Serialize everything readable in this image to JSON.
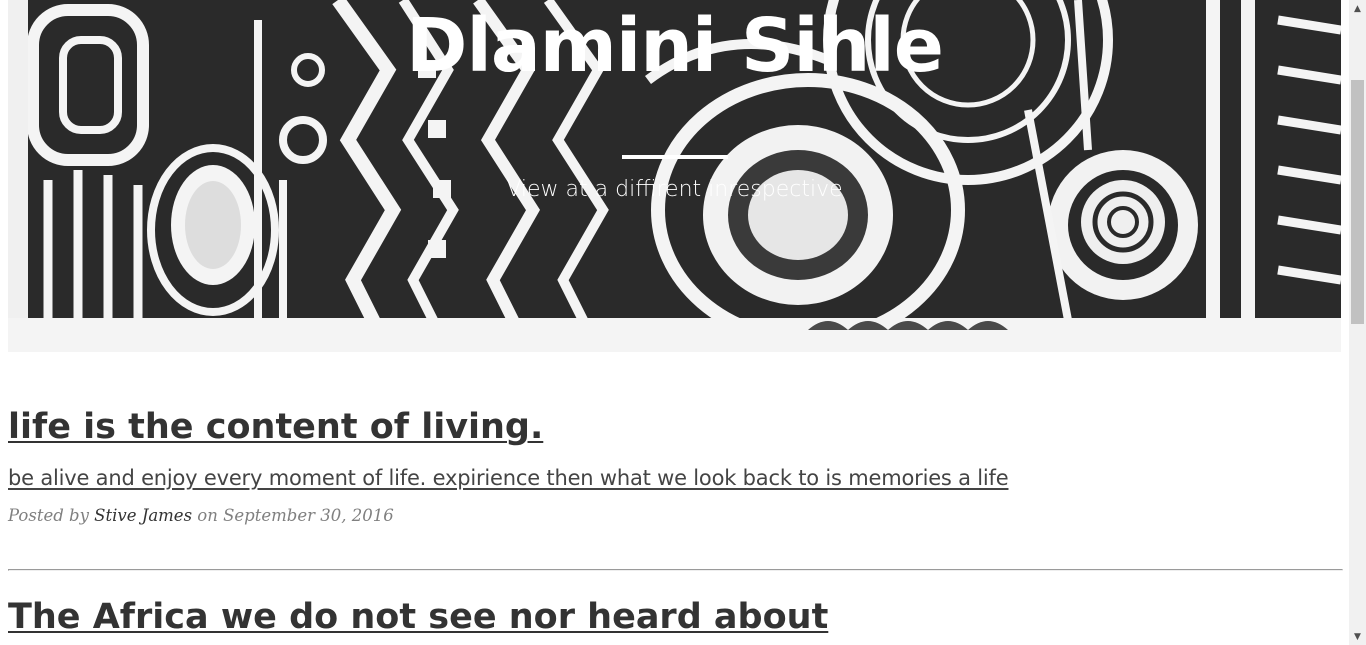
{
  "header": {
    "title": "Dlamini Sihle",
    "subtitle": "View at a diffirent inrespective"
  },
  "posts": [
    {
      "title": "life is the content of living.",
      "subtitle": "be alive and enjoy every moment of life. expirience then what we look back to is memories a life",
      "meta_prefix": "Posted by ",
      "author": "Stive James",
      "meta_on": " on ",
      "date": "September 30, 2016"
    },
    {
      "title": "The Africa we do not see nor heard about"
    }
  ],
  "scrollbar": {
    "up_icon": "▲",
    "down_icon": "▼",
    "position": 0.12
  },
  "colors": {
    "post_title": "#333333",
    "meta": "#808080",
    "hero_text": "#ffffff"
  }
}
